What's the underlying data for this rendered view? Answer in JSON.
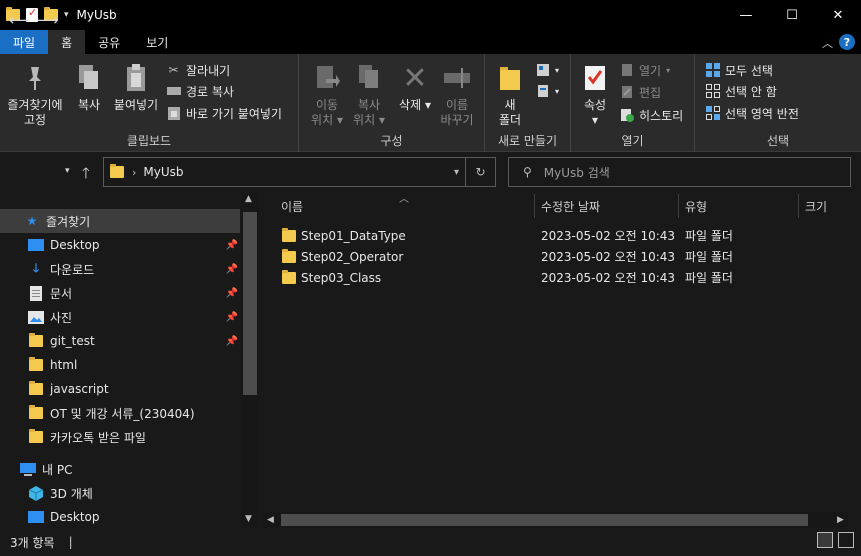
{
  "window": {
    "title": "MyUsb"
  },
  "tabs": [
    {
      "label": "파일"
    },
    {
      "label": "홈"
    },
    {
      "label": "공유"
    },
    {
      "label": "보기"
    }
  ],
  "ribbon": {
    "clipboard": {
      "label": "클립보드",
      "pin_line1": "즐겨찾기에",
      "pin_line2": "고정",
      "copy": "복사",
      "paste": "붙여넣기",
      "cut": "잘라내기",
      "copy_path": "경로 복사",
      "paste_shortcut": "바로 가기 붙여넣기"
    },
    "organize": {
      "label": "구성",
      "move_line1": "이동",
      "move_line2": "위치",
      "copyto_line1": "복사",
      "copyto_line2": "위치",
      "delete": "삭제",
      "rename_line1": "이름",
      "rename_line2": "바꾸기"
    },
    "new": {
      "label": "새로 만들기",
      "folder_line1": "새",
      "folder_line2": "폴더"
    },
    "open": {
      "label": "열기",
      "properties": "속성",
      "open": "열기",
      "edit": "편집",
      "history": "히스토리"
    },
    "select": {
      "label": "선택",
      "select_all": "모두 선택",
      "select_none": "선택 안 함",
      "invert": "선택 영역 반전"
    }
  },
  "address": {
    "path": "MyUsb",
    "search_placeholder": "MyUsb 검색"
  },
  "nav": [
    {
      "label": "즐겨찾기",
      "icon": "star-icon"
    },
    {
      "label": "Desktop",
      "icon": "desktop-icon",
      "pinned": true
    },
    {
      "label": "다운로드",
      "icon": "download-icon",
      "pinned": true
    },
    {
      "label": "문서",
      "icon": "document-icon",
      "pinned": true
    },
    {
      "label": "사진",
      "icon": "pictures-icon",
      "pinned": true
    },
    {
      "label": "git_test",
      "icon": "folder-icon",
      "pinned": true
    },
    {
      "label": "html",
      "icon": "folder-icon"
    },
    {
      "label": "javascript",
      "icon": "folder-icon"
    },
    {
      "label": "OT 및 개강 서류_(230404)",
      "icon": "folder-icon"
    },
    {
      "label": "카카오톡 받은 파일",
      "icon": "folder-icon"
    },
    {
      "label": "내 PC",
      "icon": "pc-icon"
    },
    {
      "label": "3D 개체",
      "icon": "cube-icon"
    },
    {
      "label": "Desktop",
      "icon": "desktop-icon"
    }
  ],
  "columns": {
    "name": "이름",
    "modified": "수정한 날짜",
    "type": "유형",
    "size": "크기"
  },
  "files": [
    {
      "name": "Step01_DataType",
      "modified": "2023-05-02 오전 10:43",
      "type": "파일 폴더"
    },
    {
      "name": "Step02_Operator",
      "modified": "2023-05-02 오전 10:43",
      "type": "파일 폴더"
    },
    {
      "name": "Step03_Class",
      "modified": "2023-05-02 오전 10:43",
      "type": "파일 폴더"
    }
  ],
  "status": {
    "count": "3개 항목"
  }
}
